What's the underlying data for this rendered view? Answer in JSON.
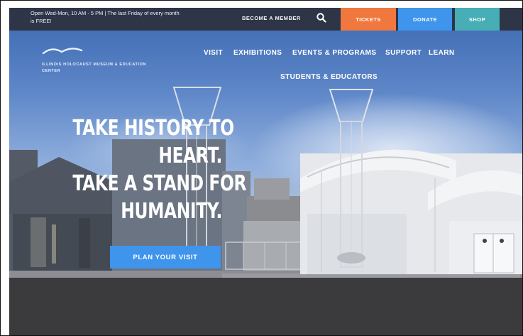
{
  "topbar": {
    "hours": "Open Wed-Mon, 10 AM - 5 PM | The last Friday of every month is FREE!",
    "member_label": "BECOME A MEMBER",
    "tickets_label": "TICKETS",
    "donate_label": "DONATE",
    "shop_label": "SHOP",
    "colors": {
      "bar": "#2e3547",
      "tickets": "#f0783f",
      "donate": "#3f94ec",
      "shop": "#46aeb4"
    }
  },
  "logo": {
    "text": "ILLINOIS HOLOCAUST MUSEUM & EDUCATION CENTER"
  },
  "nav": {
    "items": [
      "VISIT",
      "EXHIBITIONS",
      "EVENTS & PROGRAMS",
      "SUPPORT",
      "LEARN",
      "STUDENTS & EDUCATORS"
    ]
  },
  "hero": {
    "headline_lines": [
      "TAKE HISTORY TO",
      "HEART.",
      "TAKE A STAND FOR",
      "HUMANITY."
    ],
    "cta_label": "PLAN YOUR VISIT"
  }
}
